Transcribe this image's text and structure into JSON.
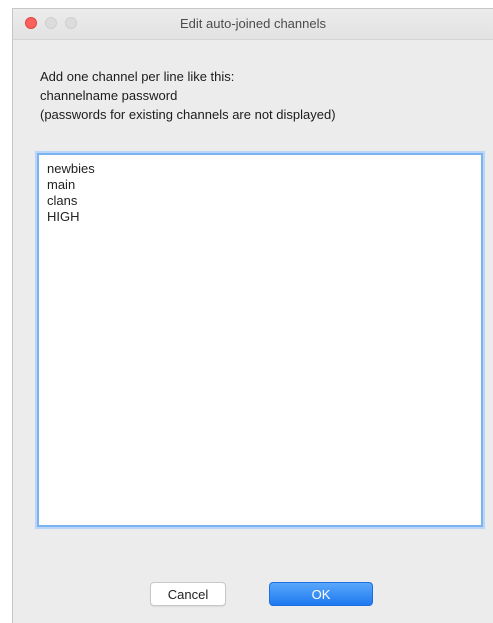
{
  "window": {
    "title": "Edit auto-joined channels"
  },
  "instructions": [
    "Add one channel per line like this:",
    "channelname password",
    "(passwords for existing channels are not displayed)"
  ],
  "channels": [
    "newbies",
    "main",
    "clans",
    "HIGH"
  ],
  "buttons": {
    "cancel_label": "Cancel",
    "ok_label": "OK"
  },
  "colors": {
    "accent": "#1e79f0",
    "close": "#fc615d"
  }
}
